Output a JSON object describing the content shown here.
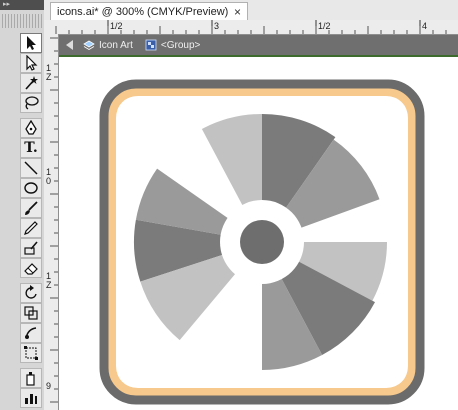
{
  "panel": {
    "title": "▸▸"
  },
  "document_tab": {
    "title": "icons.ai* @ 300% (CMYK/Preview)",
    "close_glyph": "×"
  },
  "ruler_h": {
    "labels": [
      "1/2",
      "3",
      "1/2",
      "4"
    ]
  },
  "ruler_v": {
    "labels": [
      "1\nZ",
      "1\n0",
      "1\nZ",
      "9"
    ]
  },
  "breadcrumb": {
    "layer": "Icon Art",
    "group": "<Group>"
  },
  "tools": [
    {
      "name": "selection-tool",
      "icon": "arrow-icon"
    },
    {
      "name": "direct-selection-tool",
      "icon": "hollow-arrow-icon"
    },
    {
      "name": "magic-wand-tool",
      "icon": "wand-icon"
    },
    {
      "name": "lasso-tool",
      "icon": "lasso-icon"
    },
    {
      "name": "pen-tool",
      "icon": "pen-icon"
    },
    {
      "name": "type-tool",
      "icon": "type-icon",
      "text": "T."
    },
    {
      "name": "line-tool",
      "icon": "line-icon"
    },
    {
      "name": "ellipse-tool",
      "icon": "ellipse-icon"
    },
    {
      "name": "paintbrush-tool",
      "icon": "brush-icon"
    },
    {
      "name": "pencil-tool",
      "icon": "pencil-icon"
    },
    {
      "name": "blob-brush-tool",
      "icon": "blob-brush-icon"
    },
    {
      "name": "eraser-tool",
      "icon": "eraser-icon"
    },
    {
      "name": "rotate-tool",
      "icon": "rotate-icon"
    },
    {
      "name": "scale-tool",
      "icon": "scale-icon"
    },
    {
      "name": "warp-tool",
      "icon": "warp-icon"
    },
    {
      "name": "free-transform-tool",
      "icon": "free-transform-icon"
    },
    {
      "name": "symbol-sprayer-tool",
      "icon": "symbol-sprayer-icon"
    },
    {
      "name": "graph-tool",
      "icon": "graph-icon"
    }
  ],
  "colors": {
    "frame": "#6b6b6b",
    "frame_highlight": "#f7c98c",
    "blade_dark": "#7b7b7b",
    "blade_mid": "#9a9a9a",
    "blade_light": "#c2c2c2",
    "accent_green": "#3d6b2e"
  }
}
